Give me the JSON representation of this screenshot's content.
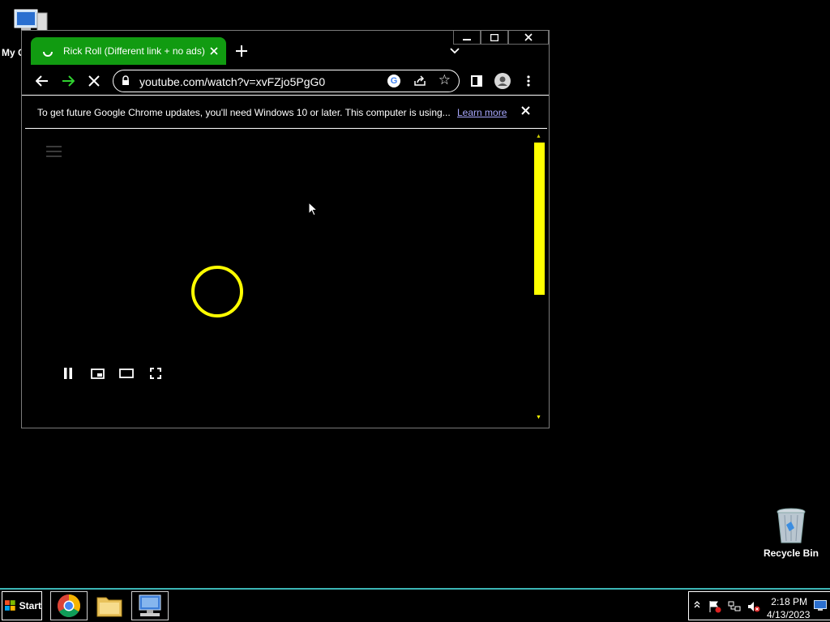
{
  "desktop": {
    "my_computer_label": "My C",
    "recycle_bin_label": "Recycle Bin"
  },
  "browser": {
    "tab_title": "Rick Roll (Different link + no ads) - Y",
    "address": "youtube.com/watch?v=xvFZjo5PgG0",
    "infobar_message": "To get future Google Chrome updates, you'll need Windows 10 or later. This computer is using...",
    "infobar_link": "Learn more"
  },
  "taskbar": {
    "start_label": "Start",
    "time": "2:18 PM",
    "date": "4/13/2023"
  },
  "colors": {
    "tab_active": "#119b11",
    "loader": "#ffff00",
    "scrollbar_thumb": "#ffff00",
    "taskbar_border": "#3bb6b6"
  }
}
